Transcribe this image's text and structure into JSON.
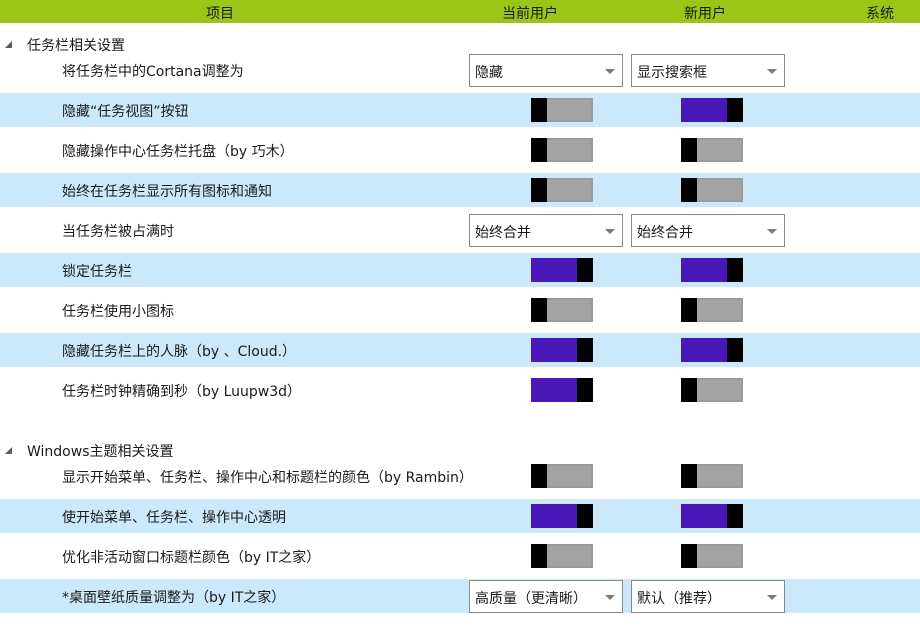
{
  "header": {
    "item": "项目",
    "current_user": "当前用户",
    "new_user": "新用户",
    "system": "系统"
  },
  "colors": {
    "header_bg": "#9bc517",
    "alt_row_bg": "#cce8fb",
    "toggle_on": "#4a17b8",
    "toggle_off": "#a3a3a3"
  },
  "groups": [
    {
      "title": "任务栏相关设置",
      "rows": [
        {
          "label": "将任务栏中的Cortana调整为",
          "type": "dropdown",
          "current": "隐藏",
          "new": "显示搜索框"
        },
        {
          "label": "隐藏“任务视图”按钮",
          "type": "toggle",
          "current": false,
          "new": true
        },
        {
          "label": "隐藏操作中心任务栏托盘（by 巧木）",
          "type": "toggle",
          "current": false,
          "new": false
        },
        {
          "label": "始终在任务栏显示所有图标和通知",
          "type": "toggle",
          "current": false,
          "new": false
        },
        {
          "label": "当任务栏被占满时",
          "type": "dropdown",
          "current": "始终合并",
          "new": "始终合并"
        },
        {
          "label": "锁定任务栏",
          "type": "toggle",
          "current": true,
          "new": true
        },
        {
          "label": "任务栏使用小图标",
          "type": "toggle",
          "current": false,
          "new": false
        },
        {
          "label": "隐藏任务栏上的人脉（by 、Cloud.）",
          "type": "toggle",
          "current": true,
          "new": true
        },
        {
          "label": "任务栏时钟精确到秒（by Luupw3d）",
          "type": "toggle",
          "current": true,
          "new": false
        }
      ]
    },
    {
      "title": "Windows主题相关设置",
      "rows": [
        {
          "label": "显示开始菜单、任务栏、操作中心和标题栏的颜色（by Rambin）",
          "type": "toggle",
          "current": false,
          "new": false
        },
        {
          "label": "使开始菜单、任务栏、操作中心透明",
          "type": "toggle",
          "current": true,
          "new": true
        },
        {
          "label": "优化非活动窗口标题栏颜色（by IT之家）",
          "type": "toggle",
          "current": false,
          "new": false
        },
        {
          "label": "*桌面壁纸质量调整为（by IT之家）",
          "type": "dropdown",
          "current": "高质量（更清晰）",
          "new": "默认（推荐）"
        }
      ]
    }
  ]
}
